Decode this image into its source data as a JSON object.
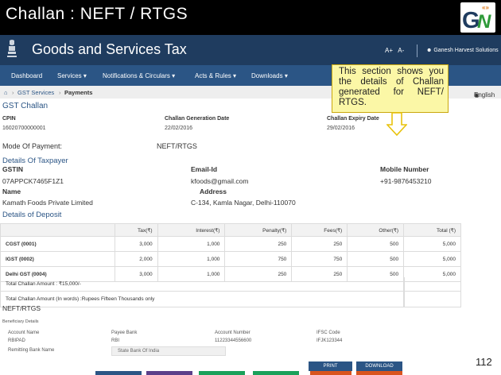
{
  "slide_title": "Challan : NEFT / RTGS",
  "logo_text": "GN",
  "header": {
    "site_title": "Goods and Services Tax",
    "font_increase": "A+",
    "font_decrease": "A-",
    "user_name": "Ganesh Harvest Solutions"
  },
  "nav": {
    "items": [
      "Dashboard",
      "Services",
      "Notifications & Circulars",
      "Acts & Rules",
      "Downloads"
    ]
  },
  "breadcrumb": {
    "home_icon": "home-icon",
    "services": "GST Services",
    "current": "Payments",
    "language": "English"
  },
  "callout": {
    "text": "This section shows you the details of Challan generated for NEFT/ RTGS."
  },
  "challan": {
    "heading": "GST Challan",
    "cpin_label": "CPIN",
    "cpin_value": "16020700000001",
    "gen_date_label": "Challan Generation Date",
    "gen_date_value": "22/02/2016",
    "expiry_label": "Challan Expiry Date",
    "expiry_value": "29/02/2016"
  },
  "payment": {
    "mode_label": "Mode Of Payment:",
    "mode_value": "NEFT/RTGS"
  },
  "taxpayer": {
    "heading": "Details Of Taxpayer",
    "gstin_label": "GSTIN",
    "gstin_value": "07APPCK7465F1Z1",
    "email_label": "Email-Id",
    "email_value": "kfoods@gmail.com",
    "mobile_label": "Mobile Number",
    "mobile_value": "+91-9876453210",
    "name_label": "Name",
    "name_value": "Kamath Foods Private Limited",
    "address_label": "Address",
    "address_value": "C-134, Kamla Nagar, Delhi-110070"
  },
  "deposit": {
    "heading": "Details of Deposit",
    "columns": [
      "",
      "Tax(₹)",
      "Interest(₹)",
      "Penalty(₹)",
      "Fees(₹)",
      "Other(₹)",
      "Total (₹)"
    ],
    "rows": [
      [
        "CGST (0001)",
        "3,000",
        "1,000",
        "250",
        "250",
        "500",
        "5,000"
      ],
      [
        "IGST (0002)",
        "2,000",
        "1,000",
        "750",
        "750",
        "500",
        "5,000"
      ],
      [
        "Delhi GST (0004)",
        "3,000",
        "1,000",
        "250",
        "250",
        "500",
        "5,000"
      ]
    ],
    "total_amount": "Total Challan Amount : ₹15,000/-",
    "total_words": "Total Challan Amount (In words) :Rupees Fifteen Thousands only"
  },
  "neft": {
    "heading": "NEFT/RTGS",
    "beneficiary_heading": "Beneficiary Details",
    "account_name_label": "Account Name",
    "account_name_value": "RBIPAD",
    "payee_bank_label": "Payee Bank",
    "payee_bank_value": "RBI",
    "account_number_label": "Account Number",
    "account_number_value": "11223344556600",
    "ifsc_label": "IFSC Code",
    "ifsc_value": "IFJK123344",
    "remitting_bank_label": "Remitting Bank Name",
    "remitting_bank_value": "State Bank Of India"
  },
  "buttons": {
    "print": "PRINT",
    "download": "DOWNLOAD"
  },
  "page_number": "112",
  "colors": {
    "header_bg": "#1f3c5f",
    "nav_bg": "#2b5585",
    "callout_bg": "#fbf7a6",
    "arrow": "#e8c20c",
    "strip_colors": [
      "#2b5585",
      "#5b3f8a",
      "#1aa15a",
      "#1aa15a",
      "#d9541e",
      "#d9541e"
    ]
  }
}
